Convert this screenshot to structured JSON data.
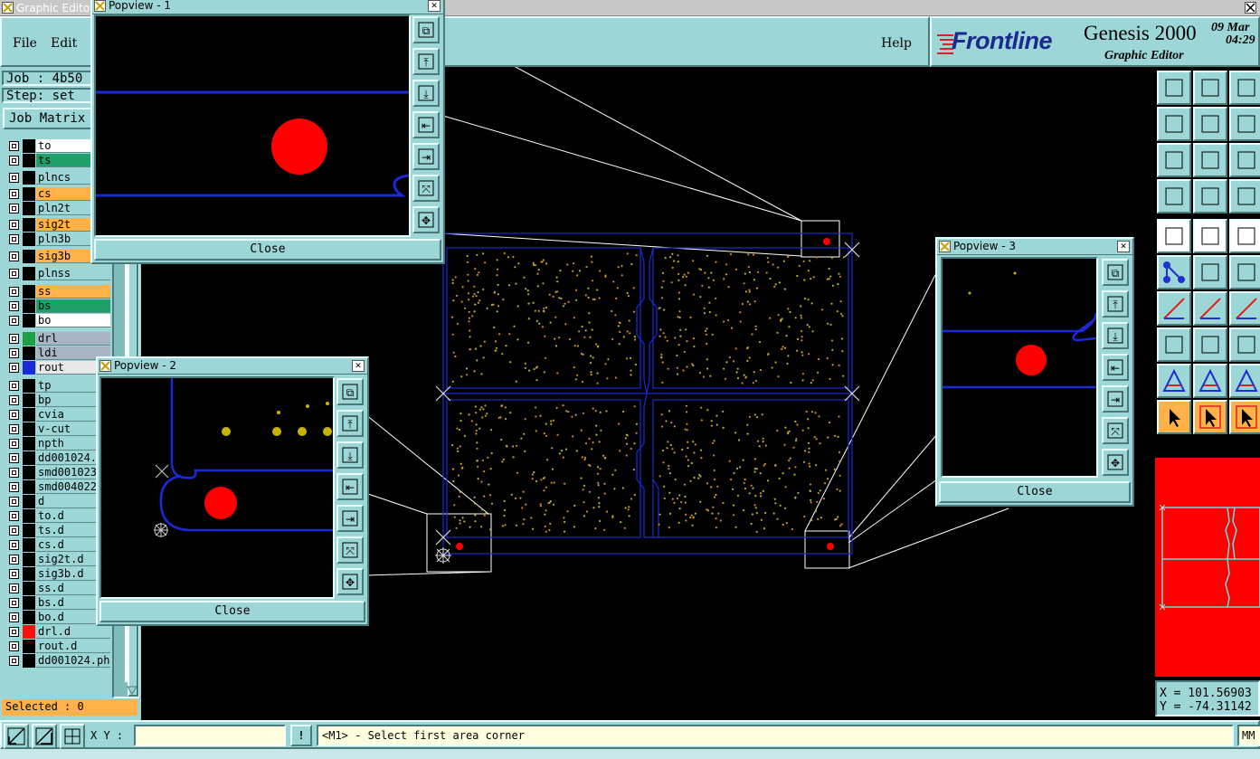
{
  "window": {
    "title": "Graphic Editor"
  },
  "menu": {
    "file": "File",
    "edit": "Edit",
    "help": "Help"
  },
  "brand": {
    "logo": "Frontline",
    "product": "Genesis 2000",
    "subtitle": "Graphic Editor",
    "date": "09 Mar",
    "time": "04:29"
  },
  "job": {
    "job_label": "Job : 4b50",
    "step_label": "Step: set",
    "matrix_button": "Job Matrix"
  },
  "layers": [
    {
      "name": "to",
      "bg": "#ffffff",
      "swatch": "#000000"
    },
    {
      "name": "ts",
      "bg": "#1fa06a",
      "swatch": "#000000"
    },
    {
      "name": "plncs",
      "bg": "#9cd6d6",
      "swatch": "#000000"
    },
    {
      "name": "cs",
      "bg": "#ffb24a",
      "swatch": "#000000"
    },
    {
      "name": "pln2t",
      "bg": "#9cd6d6",
      "swatch": "#000000"
    },
    {
      "name": "sig2t",
      "bg": "#ffb24a",
      "swatch": "#000000"
    },
    {
      "name": "pln3b",
      "bg": "#9cd6d6",
      "swatch": "#000000"
    },
    {
      "name": "sig3b",
      "bg": "#ffb24a",
      "swatch": "#000000"
    },
    {
      "name": "plnss",
      "bg": "#9cd6d6",
      "swatch": "#000000"
    },
    {
      "name": "ss",
      "bg": "#ffb24a",
      "swatch": "#000000"
    },
    {
      "name": "bs",
      "bg": "#1fa06a",
      "swatch": "#000000"
    },
    {
      "name": "bo",
      "bg": "#ffffff",
      "swatch": "#000000"
    },
    {
      "name": "drl",
      "bg": "#a8b4c4",
      "swatch": "#1fa044"
    },
    {
      "name": "ldi",
      "bg": "#a8b4c4",
      "swatch": "#000000"
    },
    {
      "name": "rout",
      "bg": "#e8e8e8",
      "swatch": "#1a2ad8"
    },
    {
      "name": "tp",
      "bg": "#9cd6d6",
      "swatch": "#000000"
    },
    {
      "name": "bp",
      "bg": "#9cd6d6",
      "swatch": "#000000"
    },
    {
      "name": "cvia",
      "bg": "#9cd6d6",
      "swatch": "#000000"
    },
    {
      "name": "v-cut",
      "bg": "#9cd6d6",
      "swatch": "#000000"
    },
    {
      "name": "npth",
      "bg": "#9cd6d6",
      "swatch": "#000000"
    },
    {
      "name": "dd001024.",
      "bg": "#9cd6d6",
      "swatch": "#000000"
    },
    {
      "name": "smd001023",
      "bg": "#9cd6d6",
      "swatch": "#000000"
    },
    {
      "name": "smd004022",
      "bg": "#9cd6d6",
      "swatch": "#000000"
    },
    {
      "name": "d",
      "bg": "#9cd6d6",
      "swatch": "#000000"
    },
    {
      "name": "to.d",
      "bg": "#9cd6d6",
      "swatch": "#000000"
    },
    {
      "name": "ts.d",
      "bg": "#9cd6d6",
      "swatch": "#000000"
    },
    {
      "name": "cs.d",
      "bg": "#9cd6d6",
      "swatch": "#000000"
    },
    {
      "name": "sig2t.d",
      "bg": "#9cd6d6",
      "swatch": "#000000"
    },
    {
      "name": "sig3b.d",
      "bg": "#9cd6d6",
      "swatch": "#000000"
    },
    {
      "name": "ss.d",
      "bg": "#9cd6d6",
      "swatch": "#000000"
    },
    {
      "name": "bs.d",
      "bg": "#9cd6d6",
      "swatch": "#000000"
    },
    {
      "name": "bo.d",
      "bg": "#9cd6d6",
      "swatch": "#000000"
    },
    {
      "name": "drl.d",
      "bg": "#9cd6d6",
      "swatch": "#ff1010"
    },
    {
      "name": "rout.d",
      "bg": "#9cd6d6",
      "swatch": "#000000"
    },
    {
      "name": "dd001024.ph",
      "bg": "#9cd6d6",
      "swatch": "#000000"
    }
  ],
  "status": {
    "selected": "Selected : 0",
    "xy_label": "X Y :",
    "xy_value": "",
    "warn": "!",
    "prompt": "<M1> - Select first area corner",
    "units": "MM"
  },
  "coords": {
    "x": "X = 101.56903",
    "y": "Y = -74.31142"
  },
  "popviews": {
    "p1": {
      "title": "Popview - 1",
      "close": "Close"
    },
    "p2": {
      "title": "Popview - 2",
      "close": "Close"
    },
    "p3": {
      "title": "Popview - 3",
      "close": "Close"
    }
  },
  "colors": {
    "panel": "#9cd6d6",
    "highlight": "#ffb24a",
    "trace": "#1a2ad8",
    "pad": "#ff0000"
  }
}
